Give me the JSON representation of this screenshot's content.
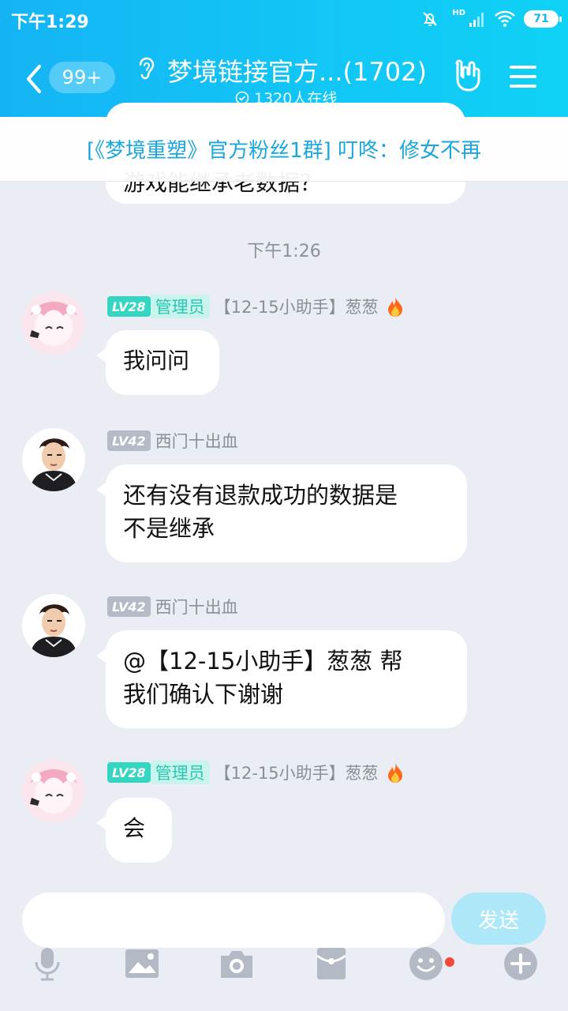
{
  "status_bar": {
    "time": "下午1:29",
    "hd": "HD",
    "battery": "71"
  },
  "header": {
    "unread": "99+",
    "group_title": "梦境链接官方...(1702)",
    "online": "1320人在线"
  },
  "old_message_fragment": "游戏能继承老数据？",
  "notice": "[《梦境重塑》官方粉丝1群] 叮咚：修女不再",
  "time_divider": "下午1:26",
  "messages": [
    {
      "level": "LV28",
      "role": "管理员",
      "sender": "【12-15小助手】葱葱",
      "text": "我问问"
    },
    {
      "level": "LV42",
      "role": "",
      "sender": "西门十出血",
      "text_line1": "还有没有退款成功的数据是",
      "text_line2": "不是继承"
    },
    {
      "level": "LV42",
      "role": "",
      "sender": "西门十出血",
      "text_line1": "@【12-15小助手】葱葱 帮",
      "text_line2": "我们确认下谢谢"
    },
    {
      "level": "LV28",
      "role": "管理员",
      "sender": "【12-15小助手】葱葱",
      "text": "会"
    }
  ],
  "input": {
    "placeholder": "",
    "send_label": "发送"
  },
  "toolbar": [
    "microphone-icon",
    "image-icon",
    "camera-icon",
    "red-packet-icon",
    "emoji-icon",
    "plus-icon"
  ],
  "colors": {
    "header_start": "#14b4f4",
    "header_end": "#0fd1f5",
    "admin_teal": "#34d6c2",
    "chat_bg": "#eaedf4"
  }
}
